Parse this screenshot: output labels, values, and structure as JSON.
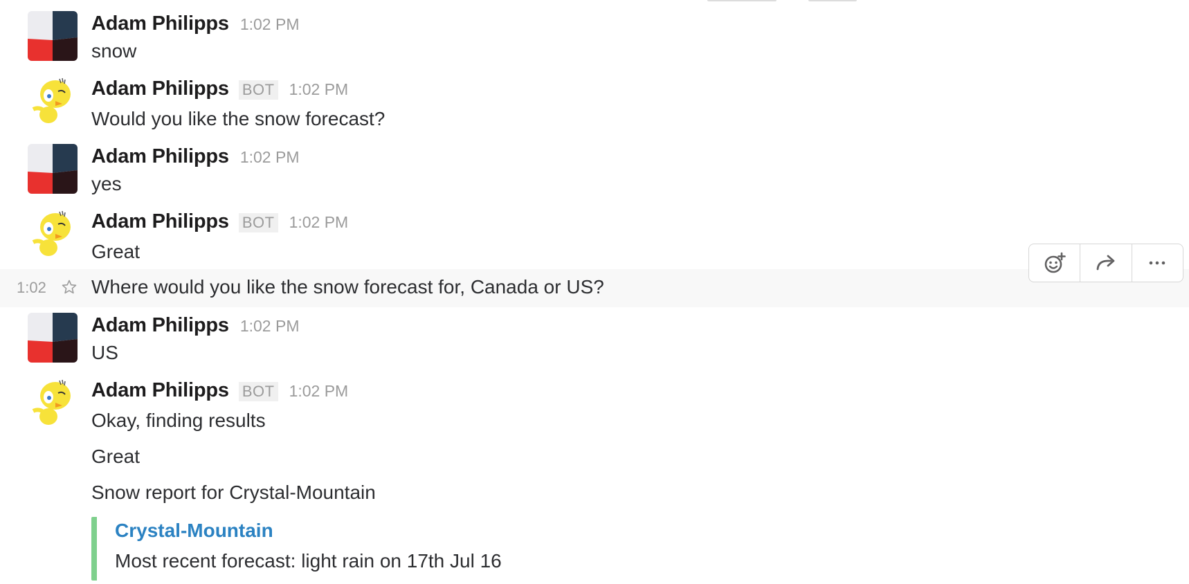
{
  "messages": [
    {
      "name": "Adam Philipps",
      "time": "1:02 PM",
      "text": "snow"
    },
    {
      "name": "Adam Philipps",
      "badge": "BOT",
      "time": "1:02 PM",
      "text": "Would you like the snow forecast?"
    },
    {
      "name": "Adam Philipps",
      "time": "1:02 PM",
      "text": "yes"
    },
    {
      "name": "Adam Philipps",
      "badge": "BOT",
      "time": "1:02 PM",
      "text": "Great"
    },
    {
      "name": "Adam Philipps",
      "time": "1:02 PM",
      "text": "US"
    },
    {
      "name": "Adam Philipps",
      "badge": "BOT",
      "time": "1:02 PM",
      "text": "Okay, finding results",
      "extra": [
        "Great",
        "Snow report for Crystal-Mountain"
      ]
    }
  ],
  "hover_message": {
    "time": "1:02",
    "text": "Where would you like the snow forecast for, Canada or US?"
  },
  "attachment": {
    "title": "Crystal-Mountain",
    "text": "Most recent forecast: light rain on 17th Jul 16",
    "border_color": "#7fd08d",
    "title_color": "#2b82c2"
  },
  "actions": [
    "add-reaction-icon",
    "share-icon",
    "more-actions-icon"
  ]
}
